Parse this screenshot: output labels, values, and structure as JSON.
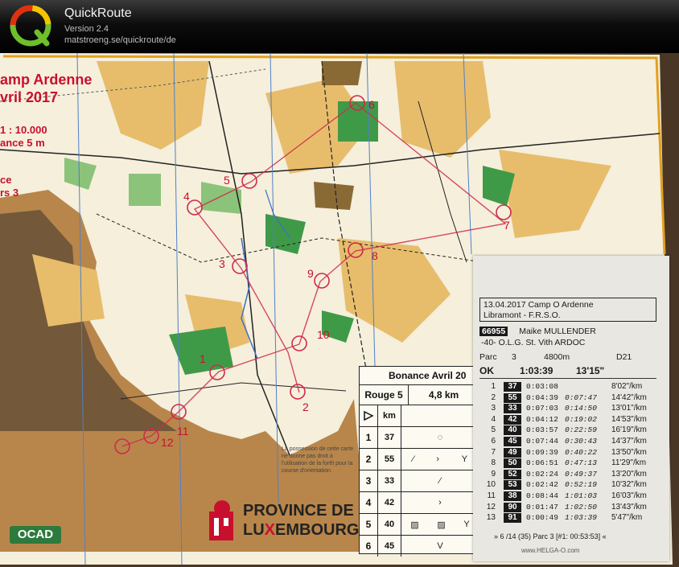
{
  "app": {
    "name": "QuickRoute",
    "version": "Version 2.4",
    "url": "matstroeng.se/quickroute/de"
  },
  "map": {
    "title_line1": "amp Ardenne",
    "title_line2": "vril 2017",
    "scale_line1": "1 : 10.000",
    "scale_line2": "ance  5 m",
    "course_line1": "ce",
    "course_line2": "rs 3",
    "controls": [
      "1",
      "2",
      "3",
      "4",
      "5",
      "6",
      "7",
      "8",
      "9",
      "10",
      "11",
      "12"
    ],
    "legal_text": "La possession de cette carte ne donne pas droit à l'utilisation de la forêt pour la course d'orientation.",
    "province_line1": "PROVINCE DE",
    "province_line2a": "LU",
    "province_line2b": "X",
    "province_line2c": "EMBOURG",
    "ocad_logo": "OCAD"
  },
  "description": {
    "title": "Bonance Avril 20",
    "course": "Rouge 5",
    "length": "4,8 km",
    "start_unit": "km",
    "rows": [
      {
        "n": "1",
        "code": "37"
      },
      {
        "n": "2",
        "code": "55"
      },
      {
        "n": "3",
        "code": "33"
      },
      {
        "n": "4",
        "code": "42"
      },
      {
        "n": "5",
        "code": "40"
      },
      {
        "n": "6",
        "code": "45"
      }
    ]
  },
  "slip": {
    "header_line1": "13.04.2017  Camp O Ardenne",
    "header_line2": "Libramont - F.R.S.O.",
    "id": "66955",
    "name": "Maike MULLENDER",
    "club": "-40-     O.L.G. St. Vith ARDOC",
    "parc_label": "Parc",
    "parc_num": "3",
    "distance": "4800m",
    "category": "D21",
    "status": "OK",
    "total_time": "1:03:39",
    "pace": "13'15\"",
    "splits": [
      {
        "n": "1",
        "code": "37",
        "leg": "0:03:08",
        "cum": "",
        "pace": "8'02\"/km"
      },
      {
        "n": "2",
        "code": "55",
        "leg": "0:04:39",
        "cum": "0:07:47",
        "pace": "14'42\"/km"
      },
      {
        "n": "3",
        "code": "33",
        "leg": "0:07:03",
        "cum": "0:14:50",
        "pace": "13'01\"/km"
      },
      {
        "n": "4",
        "code": "42",
        "leg": "0:04:12",
        "cum": "0:19:02",
        "pace": "14'53\"/km"
      },
      {
        "n": "5",
        "code": "40",
        "leg": "0:03:57",
        "cum": "0:22:59",
        "pace": "16'19\"/km"
      },
      {
        "n": "6",
        "code": "45",
        "leg": "0:07:44",
        "cum": "0:30:43",
        "pace": "14'37\"/km"
      },
      {
        "n": "7",
        "code": "49",
        "leg": "0:09:39",
        "cum": "0:40:22",
        "pace": "13'50\"/km"
      },
      {
        "n": "8",
        "code": "50",
        "leg": "0:06:51",
        "cum": "0:47:13",
        "pace": "11'29\"/km"
      },
      {
        "n": "9",
        "code": "52",
        "leg": "0:02:24",
        "cum": "0:49:37",
        "pace": "13'20\"/km"
      },
      {
        "n": "10",
        "code": "53",
        "leg": "0:02:42",
        "cum": "0:52:19",
        "pace": "10'32\"/km"
      },
      {
        "n": "11",
        "code": "38",
        "leg": "0:08:44",
        "cum": "1:01:03",
        "pace": "16'03\"/km"
      },
      {
        "n": "12",
        "code": "90",
        "leg": "0:01:47",
        "cum": "1:02:50",
        "pace": "13'43\"/km"
      },
      {
        "n": "13",
        "code": "91",
        "leg": "0:00:49",
        "cum": "1:03:39",
        "pace": "5'47\"/km"
      }
    ],
    "footer": "» 6 /14 (35) Parc  3 [#1: 00:53:53] «",
    "footer2": "www.HELGA-O.com"
  }
}
